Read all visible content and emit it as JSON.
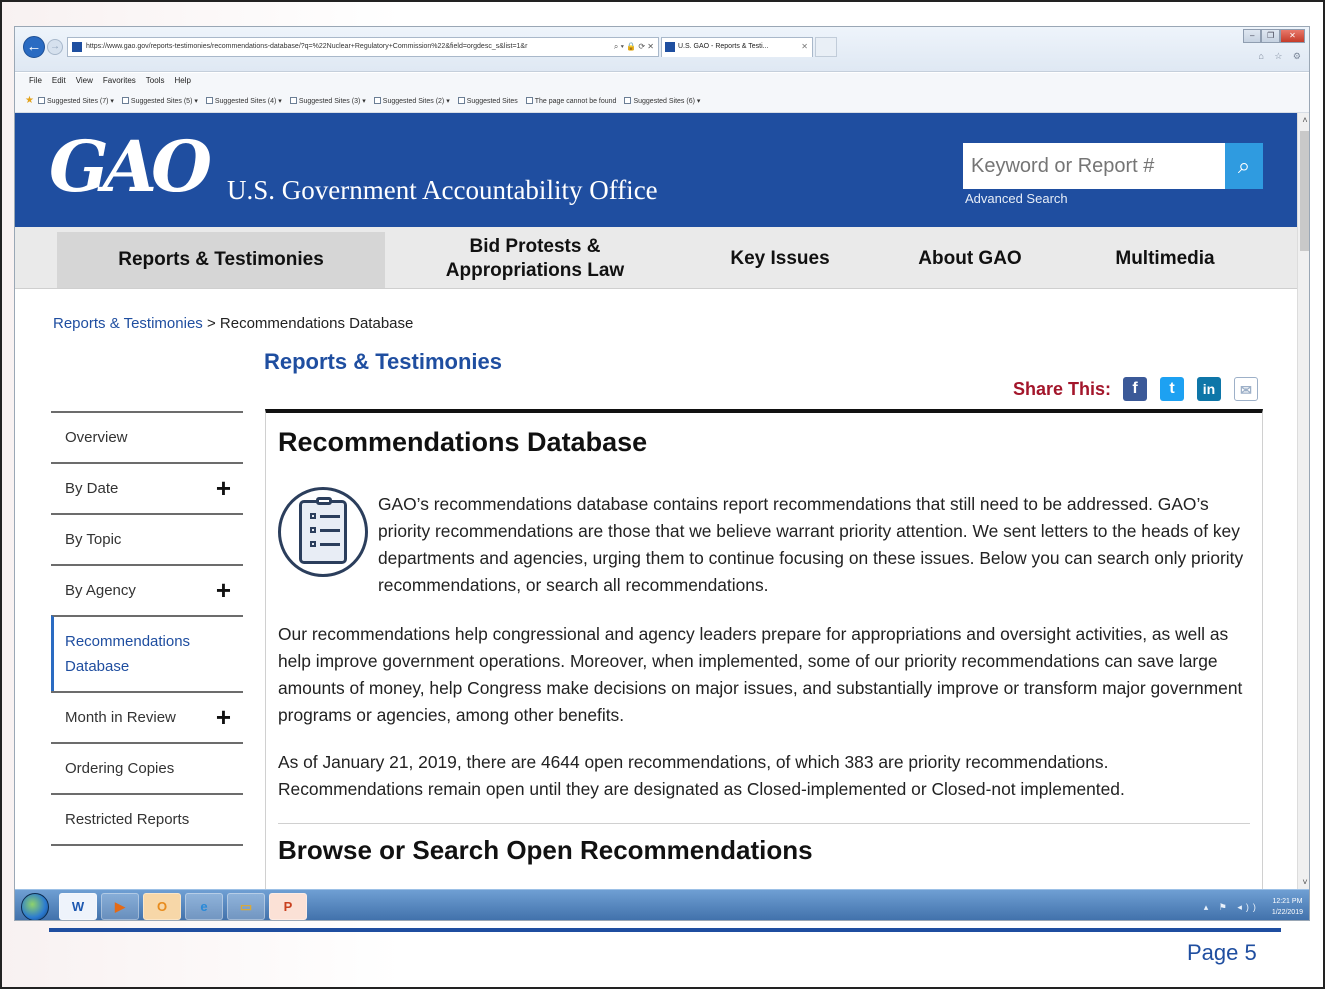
{
  "browser": {
    "address": "https://www.gao.gov/reports-testimonies/recommendations-database/?q=%22Nuclear+Regulatory+Commission%22&field=orgdesc_s&list=1&r",
    "tab_title": "U.S. GAO - Reports & Testi...",
    "menu": [
      "File",
      "Edit",
      "View",
      "Favorites",
      "Tools",
      "Help"
    ],
    "favorites": [
      "Suggested Sites (7)",
      "Suggested Sites (5)",
      "Suggested Sites (4)",
      "Suggested Sites (3)",
      "Suggested Sites (2)",
      "Suggested Sites",
      "The page cannot be found",
      "Suggested Sites (6)"
    ]
  },
  "header": {
    "logo": "GAO",
    "agency": "U.S. Government Accountability Office",
    "search_placeholder": "Keyword or Report #",
    "advanced_search": "Advanced Search"
  },
  "nav": {
    "reports": "Reports & Testimonies",
    "bid_line1": "Bid Protests &",
    "bid_line2": "Appropriations Law",
    "key_issues": "Key Issues",
    "about": "About GAO",
    "multimedia": "Multimedia"
  },
  "breadcrumb": {
    "link": "Reports & Testimonies",
    "separator": " > ",
    "current": "Recommendations Database"
  },
  "section_title": "Reports & Testimonies",
  "share": {
    "label": "Share This:",
    "icons": [
      "facebook-icon",
      "twitter-icon",
      "linkedin-icon",
      "email-icon"
    ]
  },
  "sidebar": {
    "items": [
      {
        "label": "Overview"
      },
      {
        "label": "By Date"
      },
      {
        "label": "By Topic"
      },
      {
        "label": "By Agency"
      },
      {
        "label": "Recommendations Database"
      },
      {
        "label": "Month in Review"
      },
      {
        "label": "Ordering Copies"
      },
      {
        "label": "Restricted Reports"
      }
    ]
  },
  "content": {
    "title": "Recommendations Database",
    "intro": "GAO’s recommendations database contains report recommendations that still need to be addressed. GAO’s priority recommendations are those that we believe warrant priority attention. We sent letters to the heads of key departments and agencies, urging them to continue focusing on these issues. Below you can search only priority recommendations, or search all recommendations.",
    "para2": "Our recommendations help congressional and agency leaders prepare for appropriations and oversight activities, as well as help improve government operations. Moreover, when implemented, some of our priority recommendations can save large amounts of money, help Congress make decisions on major issues, and substantially improve or transform major government programs or agencies, among other benefits.",
    "para3": "As of January 21, 2019, there are 4644 open recommendations, of which 383 are priority recommendations. Recommendations remain open until they are designated as Closed-implemented or Closed-not implemented.",
    "browse_title": "Browse or Search Open Recommendations"
  },
  "taskbar": {
    "time": "12:21 PM",
    "date": "1/22/2019"
  },
  "slide": {
    "page": "Page 5"
  }
}
